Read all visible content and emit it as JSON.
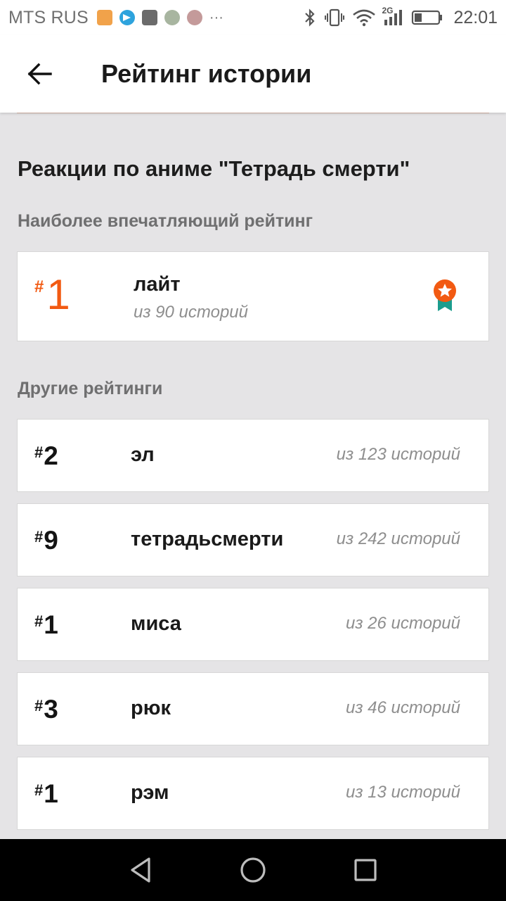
{
  "status_bar": {
    "carrier": "MTS RUS",
    "network": "2G",
    "time": "22:01",
    "more": "···"
  },
  "header": {
    "title": "Рейтинг истории"
  },
  "section_title": "Реакции по аниме \"Тетрадь смерти\"",
  "top_rating": {
    "heading": "Наиболее впечатляющий рейтинг",
    "hash": "#",
    "rank": "1",
    "tag": "лайт",
    "count": "из 90 историй",
    "accent_color": "#f25a12"
  },
  "other_ratings": {
    "heading": "Другие рейтинги",
    "items": [
      {
        "hash": "#",
        "rank": "2",
        "tag": "эл",
        "count": "из 123 историй"
      },
      {
        "hash": "#",
        "rank": "9",
        "tag": "тетрадьсмерти",
        "count": "из 242 историй"
      },
      {
        "hash": "#",
        "rank": "1",
        "tag": "миса",
        "count": "из 26 историй"
      },
      {
        "hash": "#",
        "rank": "3",
        "tag": "рюк",
        "count": "из 46 историй"
      },
      {
        "hash": "#",
        "rank": "1",
        "tag": "рэм",
        "count": "из 13 историй"
      }
    ]
  },
  "nav_bar": {
    "icons": [
      "back-triangle-icon",
      "home-circle-icon",
      "recents-square-icon"
    ]
  }
}
